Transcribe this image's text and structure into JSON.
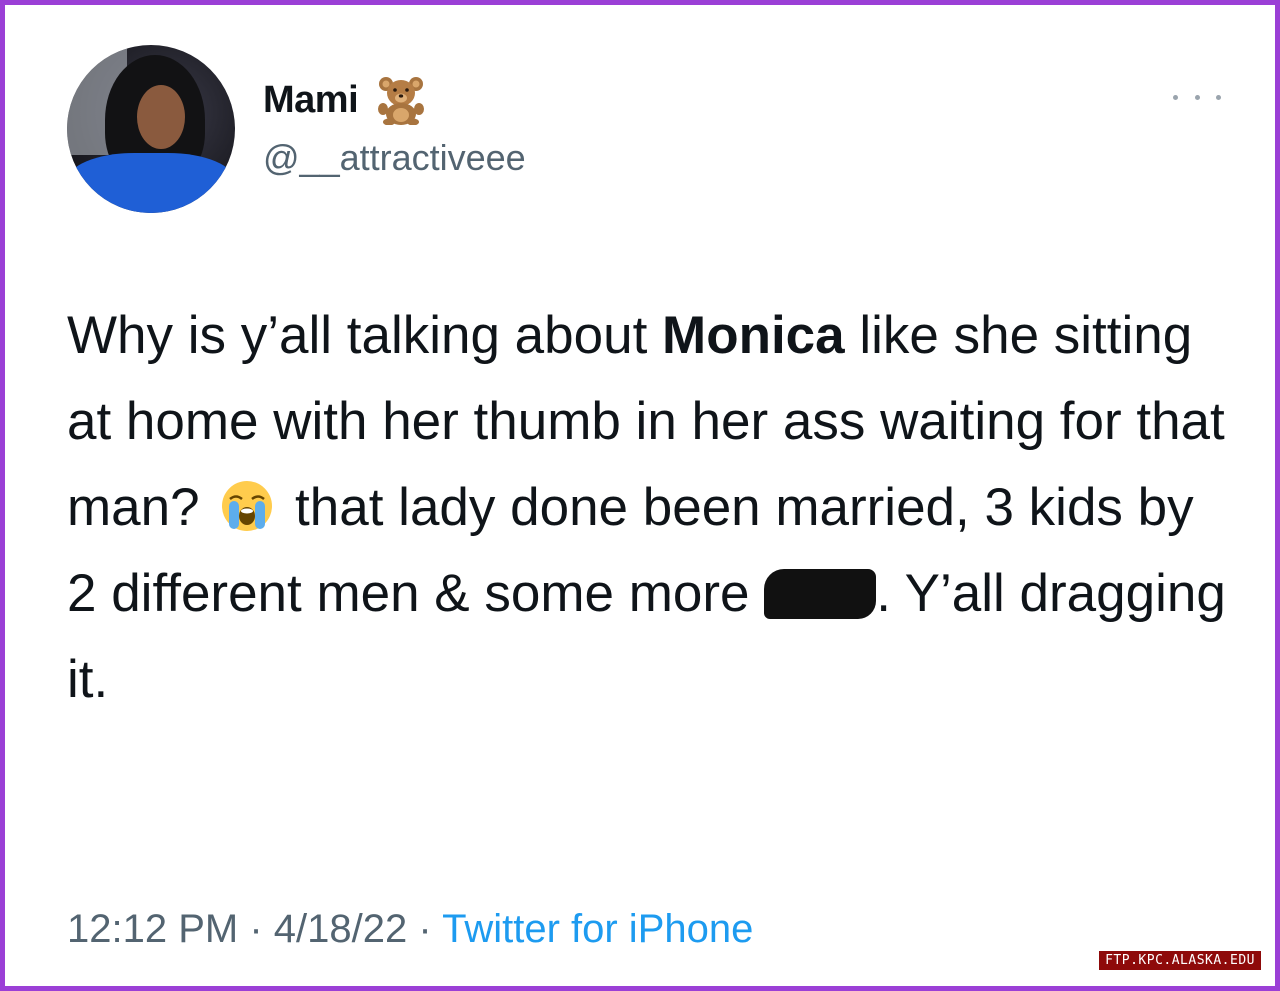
{
  "tweet": {
    "display_name": "Mami",
    "name_emoji_icon": "teddy-bear-icon",
    "handle": "@__attractiveee",
    "text_parts": {
      "p1": "Why is y’all talking about ",
      "bold": "Monica",
      "p2": " like she sitting at home with her thumb in her ass waiting for that man? ",
      "emoji": "loudly-crying-face-icon",
      "p3": " that lady done been married, 3 kids by 2 different men & some more ",
      "redacted": "redaction-mark",
      "p4": ". Y’all dragging it."
    },
    "time": "12:12 PM",
    "separator": "·",
    "date": "4/18/22",
    "source": "Twitter for iPhone"
  },
  "watermark": "FTP.KPC.ALASKA.EDU",
  "colors": {
    "border": "#9b3fd6",
    "link": "#1d9bf0",
    "secondary_text": "#536471",
    "watermark_bg": "#8e0a0a"
  }
}
